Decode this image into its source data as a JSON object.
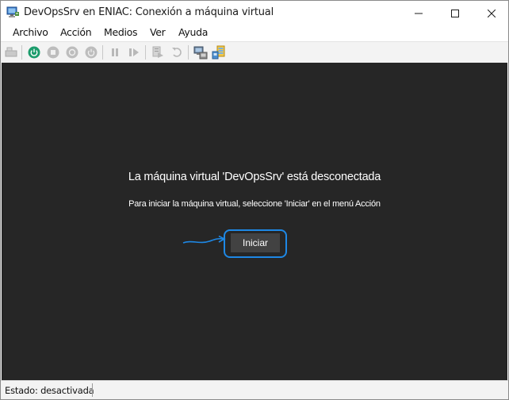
{
  "window": {
    "title": "DevOpsSrv en ENIAC: Conexión a máquina virtual",
    "controls": {
      "minimize": "minimize-icon",
      "maximize": "maximize-icon",
      "close": "close-icon"
    }
  },
  "menu": {
    "items": [
      "Archivo",
      "Acción",
      "Medios",
      "Ver",
      "Ayuda"
    ]
  },
  "toolbar": {
    "buttons": [
      {
        "name": "ctrl-alt-del",
        "icon": "keyboard-icon",
        "enabled": false
      },
      {
        "name": "start",
        "icon": "power-icon",
        "enabled": true,
        "color": "#1c9c6c"
      },
      {
        "name": "turn-off",
        "icon": "stop-icon",
        "enabled": false
      },
      {
        "name": "shut-down",
        "icon": "shutdown-icon",
        "enabled": false
      },
      {
        "name": "save",
        "icon": "save-state-icon",
        "enabled": false
      },
      {
        "name": "pause",
        "icon": "pause-icon",
        "enabled": false
      },
      {
        "name": "resume",
        "icon": "resume-icon",
        "enabled": false
      },
      {
        "name": "checkpoint",
        "icon": "checkpoint-icon",
        "enabled": false
      },
      {
        "name": "revert",
        "icon": "revert-icon",
        "enabled": false
      },
      {
        "name": "enhanced-session",
        "icon": "enhanced-session-icon",
        "enabled": true
      },
      {
        "name": "share",
        "icon": "share-icon",
        "enabled": true
      }
    ]
  },
  "display": {
    "heading": "La máquina virtual 'DevOpsSrv' está desconectada",
    "instruction": "Para iniciar la máquina virtual, seleccione 'Iniciar' en el menú Acción",
    "start_button": "Iniciar",
    "background": "#262626",
    "highlight_color": "#1e88e5"
  },
  "status": {
    "text": "Estado: desactivada"
  }
}
